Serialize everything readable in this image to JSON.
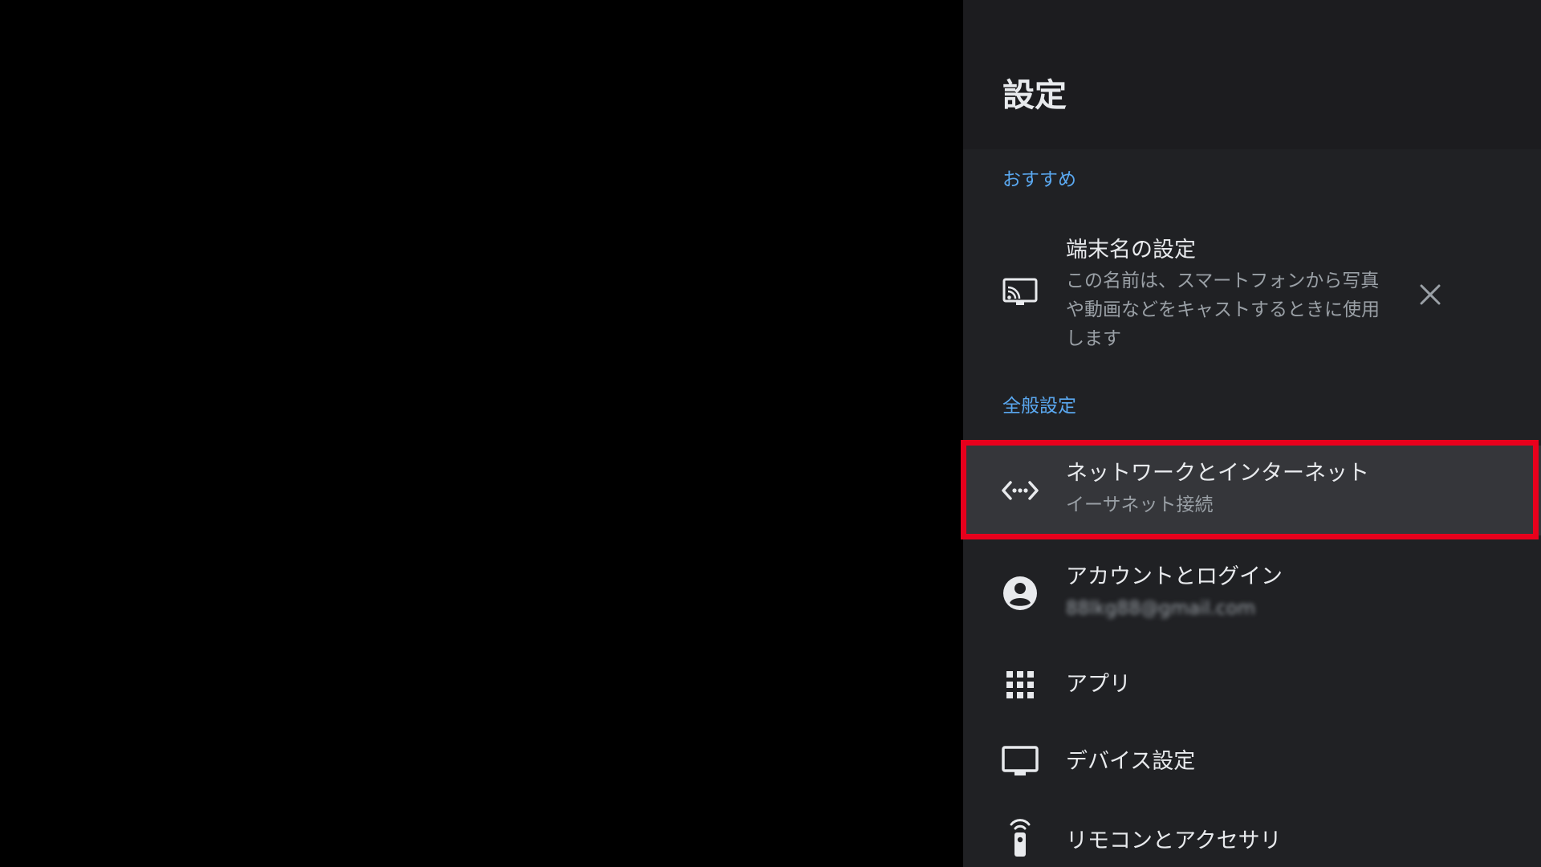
{
  "settings": {
    "title": "設定",
    "sections": {
      "recommended": "おすすめ",
      "general": "全般設定"
    },
    "suggestion": {
      "title": "端末名の設定",
      "description_lines": [
        "この名前は、スマートフォンから写真",
        "や動画などをキャストするときに使用",
        "します"
      ],
      "icon": "cast-icon",
      "dismiss_icon": "close-icon"
    },
    "items": [
      {
        "title": "ネットワークとインターネット",
        "subtitle": "イーサネット接続",
        "icon": "network-icon",
        "selected": true
      },
      {
        "title": "アカウントとログイン",
        "subtitle": "88lkg88@gmail.com",
        "icon": "account-icon",
        "subtitle_blurred": true
      },
      {
        "title": "アプリ",
        "icon": "apps-grid-icon"
      },
      {
        "title": "デバイス設定",
        "icon": "tv-icon"
      },
      {
        "title": "リモコンとアクセサリ",
        "icon": "remote-icon"
      }
    ]
  },
  "colors": {
    "background": "#000000",
    "panel": "#202124",
    "header": "#1c1c1f",
    "accent": "#5aa8f0",
    "selected_row": "#35363a",
    "focus_frame": "#e8001c"
  }
}
